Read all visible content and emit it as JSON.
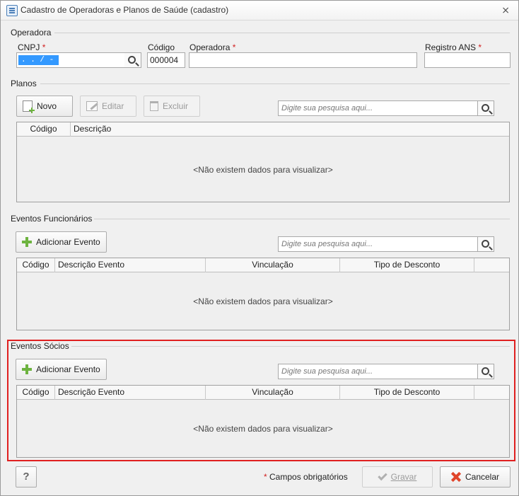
{
  "window": {
    "title": "Cadastro de Operadoras e Planos de Saúde (cadastro)",
    "close": "⨯"
  },
  "operadora": {
    "section_title": "Operadora",
    "cnpj_label": "CNPJ",
    "cnpj_value": " .  .  /   -",
    "codigo_label": "Código",
    "codigo_value": "000004",
    "operadora_label": "Operadora",
    "operadora_value": "",
    "registro_label": "Registro ANS",
    "registro_value": "",
    "required_mark": "*"
  },
  "planos": {
    "section_title": "Planos",
    "buttons": {
      "novo": "Novo",
      "editar": "Editar",
      "excluir": "Excluir"
    },
    "search_placeholder": "Digite sua pesquisa aqui...",
    "columns": [
      "Código",
      "Descrição"
    ],
    "empty_message": "<Não existem dados para visualizar>"
  },
  "eventos_funcionarios": {
    "section_title": "Eventos Funcionários",
    "add_button": "Adicionar Evento",
    "search_placeholder": "Digite sua pesquisa aqui...",
    "columns": [
      "Código",
      "Descrição Evento",
      "Vinculação",
      "Tipo de Desconto",
      ""
    ],
    "empty_message": "<Não existem dados para visualizar>"
  },
  "eventos_socios": {
    "section_title": "Eventos Sócios",
    "add_button": "Adicionar Evento",
    "search_placeholder": "Digite sua pesquisa aqui...",
    "columns": [
      "Código",
      "Descrição Evento",
      "Vinculação",
      "Tipo de Desconto",
      ""
    ],
    "empty_message": "<Não existem dados para visualizar>"
  },
  "footer": {
    "help": "?",
    "required_note": "Campos obrigatórios",
    "required_mark": "*",
    "gravar": "Gravar",
    "cancelar": "Cancelar"
  },
  "colors": {
    "highlight": "#e02020",
    "selection": "#3399ff",
    "required": "#d12020"
  }
}
